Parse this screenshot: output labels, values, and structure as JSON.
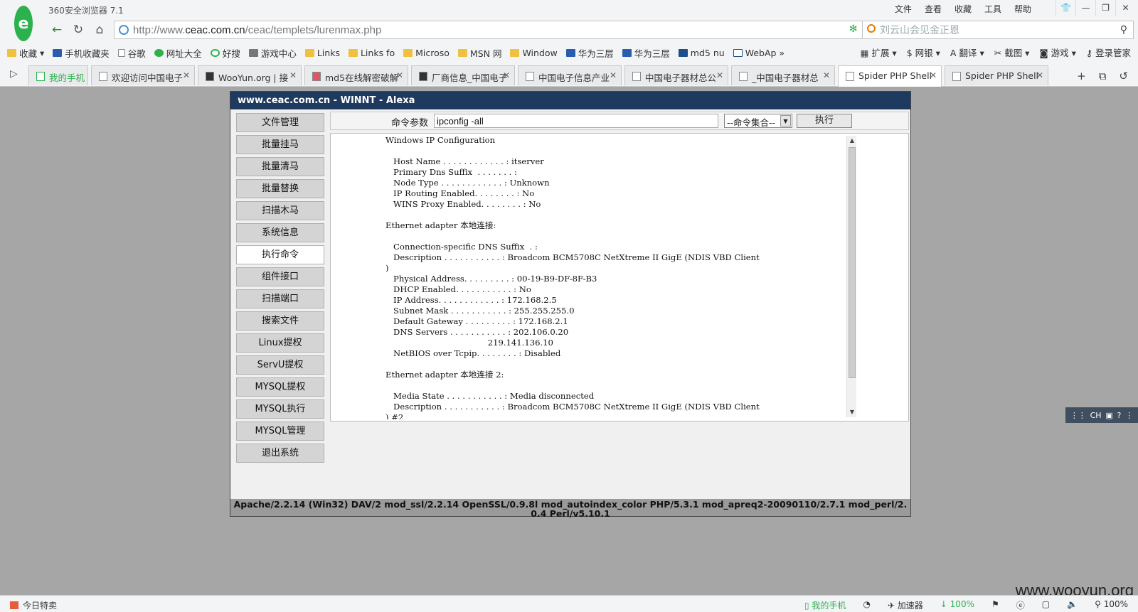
{
  "browser": {
    "title": "360安全浏览器 7.1",
    "menu": [
      "文件",
      "查看",
      "收藏",
      "工具",
      "帮助"
    ],
    "window_controls": [
      "衣",
      "—",
      "❐",
      "✕"
    ],
    "url_prefix": "http://www.",
    "url_domain": "ceac.com.cn",
    "url_path": "/ceac/templets/lurenmax.php",
    "search_placeholder": "刘云山会见金正恩",
    "bookmarks": [
      {
        "label": "收藏",
        "icon": "star-icon"
      },
      {
        "label": "手机收藏夹",
        "icon": "phone-icon"
      },
      {
        "label": "谷歌",
        "icon": "page-icon"
      },
      {
        "label": "网址大全",
        "icon": "globe-icon"
      },
      {
        "label": "好搜",
        "icon": "search-icon"
      },
      {
        "label": "游戏中心",
        "icon": "gamepad-icon"
      },
      {
        "label": "Links",
        "icon": "folder-icon"
      },
      {
        "label": "Links fo",
        "icon": "folder-icon"
      },
      {
        "label": "Microso",
        "icon": "folder-icon"
      },
      {
        "label": "MSN 网",
        "icon": "folder-icon"
      },
      {
        "label": "Window",
        "icon": "folder-icon"
      },
      {
        "label": "华为三层",
        "icon": "paw-icon"
      },
      {
        "label": "华为三层",
        "icon": "paw-icon"
      },
      {
        "label": "md5 nu",
        "icon": "t-icon"
      },
      {
        "label": "WebAp",
        "icon": "shield-icon"
      }
    ],
    "bookmarks_right": [
      "扩展",
      "网银",
      "翻译",
      "截图",
      "游戏",
      "登录管家"
    ],
    "tabs": [
      {
        "label": "我的手机",
        "active": false
      },
      {
        "label": "欢迎访问中国电子",
        "active": false
      },
      {
        "label": "WooYun.org | 接",
        "active": false
      },
      {
        "label": "md5在线解密破解",
        "active": false
      },
      {
        "label": "厂商信息_中国电子",
        "active": false
      },
      {
        "label": "中国电子信息产业",
        "active": false
      },
      {
        "label": "中国电子器材总公",
        "active": false
      },
      {
        "label": "_中国电子器材总",
        "active": false
      },
      {
        "label": "Spider PHP Shell",
        "active": true
      },
      {
        "label": "Spider PHP Shell",
        "active": false
      }
    ]
  },
  "shell": {
    "header": "www.ceac.com.cn - WINNT - Alexa",
    "sidebar": [
      "文件管理",
      "批量挂马",
      "批量清马",
      "批量替换",
      "扫描木马",
      "系统信息",
      "执行命令",
      "组件接口",
      "扫描端口",
      "搜索文件",
      "Linux提权",
      "ServU提权",
      "MYSQL提权",
      "MYSQL执行",
      "MYSQL管理",
      "退出系统"
    ],
    "active_item": "执行命令",
    "cmd_label": "命令参数",
    "cmd_value": "ipconfig -all",
    "cmd_select": "--命令集合--",
    "exec_label": "执行",
    "output_lines": [
      "Windows IP Configuration",
      "",
      "   Host Name . . . . . . . . . . . . : itserver",
      "   Primary Dns Suffix  . . . . . . . :",
      "   Node Type . . . . . . . . . . . . : Unknown",
      "   IP Routing Enabled. . . . . . . . : No",
      "   WINS Proxy Enabled. . . . . . . . : No",
      "",
      "Ethernet adapter 本地连接:",
      "",
      "   Connection-specific DNS Suffix  . :",
      "   Description . . . . . . . . . . . : Broadcom BCM5708C NetXtreme II GigE (NDIS VBD Client",
      ")",
      "   Physical Address. . . . . . . . . : 00-19-B9-DF-8F-B3",
      "   DHCP Enabled. . . . . . . . . . . : No",
      "   IP Address. . . . . . . . . . . . : 172.168.2.5",
      "   Subnet Mask . . . . . . . . . . . : 255.255.255.0",
      "   Default Gateway . . . . . . . . . : 172.168.2.1",
      "   DNS Servers . . . . . . . . . . . : 202.106.0.20",
      "                                       219.141.136.10",
      "   NetBIOS over Tcpip. . . . . . . . : Disabled",
      "",
      "Ethernet adapter 本地连接 2:",
      "",
      "   Media State . . . . . . . . . . . : Media disconnected",
      "   Description . . . . . . . . . . . : Broadcom BCM5708C NetXtreme II GigE (NDIS VBD Client",
      ") #2"
    ],
    "server_info": "Apache/2.2.14 (Win32) DAV/2 mod_ssl/2.2.14 OpenSSL/0.9.8l mod_autoindex_color PHP/5.3.1 mod_apreq2-20090110/2.7.1 mod_perl/2.0.4 Perl/v5.10.1"
  },
  "ime": {
    "label": "CH"
  },
  "status": {
    "left": "今日特卖",
    "right": [
      "我的手机",
      "加速器",
      "100%",
      "100%"
    ]
  },
  "watermark": "www.wooyun.org"
}
